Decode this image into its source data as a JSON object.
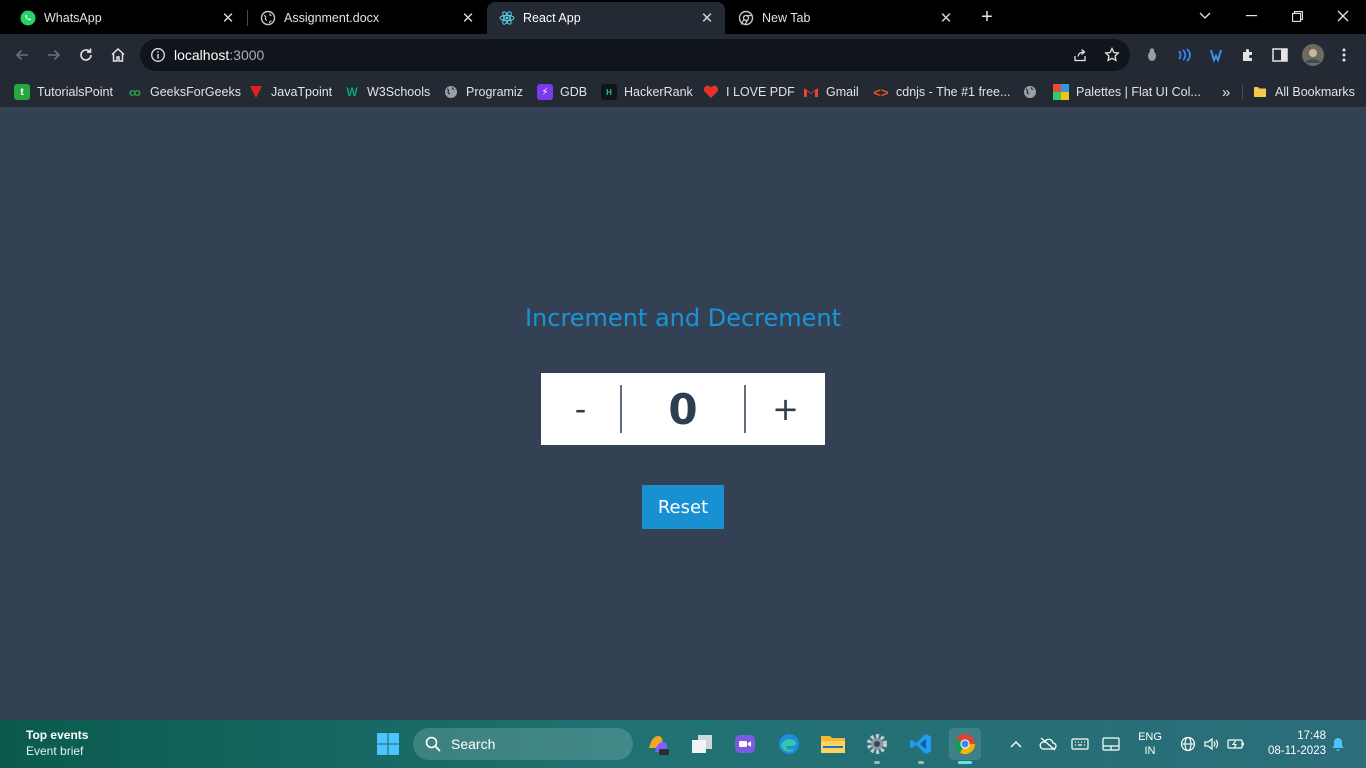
{
  "browser": {
    "tabs": [
      {
        "title": "WhatsApp",
        "icon": "whatsapp-icon",
        "active": false
      },
      {
        "title": "Assignment.docx",
        "icon": "globe-icon",
        "active": false
      },
      {
        "title": "React App",
        "icon": "react-icon",
        "active": true
      },
      {
        "title": "New Tab",
        "icon": "chrome-icon",
        "active": false
      }
    ],
    "address": {
      "host": "localhost",
      "port": ":3000"
    },
    "bookmarks": [
      {
        "label": "TutorialsPoint"
      },
      {
        "label": "GeeksForGeeks"
      },
      {
        "label": "JavaTpoint"
      },
      {
        "label": "W3Schools"
      },
      {
        "label": "Programiz"
      },
      {
        "label": "GDB"
      },
      {
        "label": "HackerRank"
      },
      {
        "label": "I LOVE PDF"
      },
      {
        "label": "Gmail"
      },
      {
        "label": "cdnjs - The #1 free..."
      },
      {
        "label": ""
      },
      {
        "label": "Palettes | Flat UI Col..."
      }
    ],
    "bookmarks_overflow": "»",
    "all_bookmarks": "All Bookmarks"
  },
  "app": {
    "title": "Increment and Decrement",
    "decrement_label": "-",
    "count": "0",
    "increment_label": "+",
    "reset_label": "Reset",
    "colors": {
      "heading": "#1995d6",
      "background": "#344154",
      "button": "#1890d2"
    }
  },
  "taskbar": {
    "news_title": "Top events",
    "news_sub": "Event brief",
    "search_label": "Search",
    "lang_line1": "ENG",
    "lang_line2": "IN",
    "time": "17:48",
    "date": "08-11-2023"
  }
}
